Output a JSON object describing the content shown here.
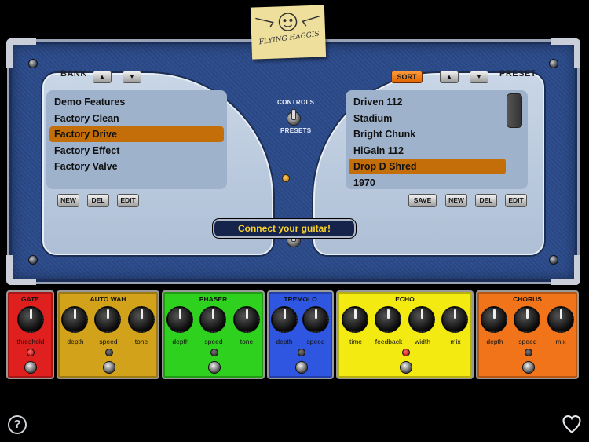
{
  "bank": {
    "header": "BANK",
    "up_label": "▲",
    "down_label": "▼",
    "items": [
      "Demo Features",
      "Factory Clean",
      "Factory Drive",
      "Factory Effect",
      "Factory Valve"
    ],
    "selected": "Factory Drive",
    "buttons": {
      "new": "NEW",
      "del": "DEL",
      "edit": "EDIT"
    }
  },
  "preset": {
    "header": "PRESET",
    "sort_label": "SORT",
    "up_label": "▲",
    "down_label": "▼",
    "items": [
      "Driven 112",
      "Stadium",
      "Bright Chunk",
      "HiGain 112",
      "Drop D Shred",
      "1970"
    ],
    "selected": "Drop D Shred",
    "buttons": {
      "save": "SAVE",
      "new": "NEW",
      "del": "DEL",
      "edit": "EDIT"
    }
  },
  "center": {
    "logo_text": "FLYING HAGGIS",
    "controls_label": "CONTROLS",
    "presets_label": "PRESETS",
    "connect_message": "Connect your guitar!"
  },
  "pedals": {
    "gate": {
      "title": "GATE",
      "color": "#e01f1f",
      "knobs": [
        "threshold"
      ]
    },
    "autowah": {
      "title": "AUTO WAH",
      "color": "#d1a21a",
      "knobs": [
        "depth",
        "speed",
        "tone"
      ]
    },
    "phaser": {
      "title": "PHASER",
      "color": "#2ed11d",
      "knobs": [
        "depth",
        "speed",
        "tone"
      ]
    },
    "tremolo": {
      "title": "TREMOLO",
      "color": "#2f56e0",
      "knobs": [
        "depth",
        "speed"
      ]
    },
    "echo": {
      "title": "ECHO",
      "color": "#f3ea12",
      "knobs": [
        "time",
        "feedback",
        "width",
        "mix"
      ]
    },
    "chorus": {
      "title": "CHORUS",
      "color": "#f2741a",
      "knobs": [
        "depth",
        "speed",
        "mix"
      ]
    }
  },
  "footer": {
    "help_label": "?",
    "help_icon": "question-circle-icon",
    "favorite_icon": "heart-icon"
  }
}
